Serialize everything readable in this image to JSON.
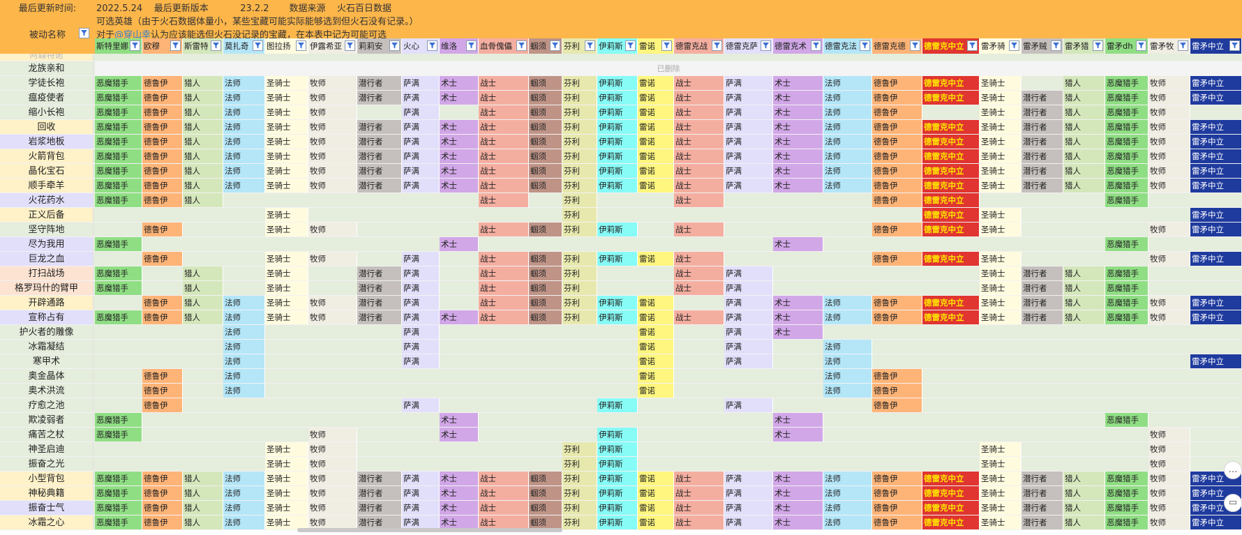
{
  "meta_header": {
    "update_time_label": "最后更新时间:",
    "date": "2022.5.24",
    "version_label": "最后更新版本",
    "version": "23.2.2",
    "source_label": "数据来源",
    "source": "火石百日数据",
    "note1": "可选英雄（由于火石数据体量小，某些宝藏可能实际能够选到但火石没有记录。）",
    "note2_prefix": "对于",
    "note2_mention": "@穿山幸",
    "note2_suffix": "认为应该能选但火石没记录的宝藏，在本表中记为可能可选",
    "name_header": "被动名称"
  },
  "columns": [
    {
      "label": "斯特里娜",
      "bg": "#90de84"
    },
    {
      "label": "欧穆",
      "bg": "#ffb477"
    },
    {
      "label": "斯雷特",
      "bg": "#d4e7bb"
    },
    {
      "label": "莫扎奇",
      "bg": "#b4e6f8"
    },
    {
      "label": "图拉扬",
      "bg": "#fffbdf"
    },
    {
      "label": "伊露希亚",
      "bg": "#f0ede3"
    },
    {
      "label": "莉莉安",
      "bg": "#c5c0bd"
    },
    {
      "label": "火心",
      "bg": "#e2dffb"
    },
    {
      "label": "维洛",
      "bg": "#d1a7e7"
    },
    {
      "label": "血骨傀儡",
      "bg": "#f4aea0"
    },
    {
      "label": "蝈须",
      "bg": "#bf9487"
    },
    {
      "label": "芬利",
      "bg": "#e7e8ad"
    },
    {
      "label": "伊莉斯",
      "bg": "#87fbf6"
    },
    {
      "label": "雷诺",
      "bg": "#fef67e"
    },
    {
      "label": "德雷克战",
      "bg": "#f4aea0"
    },
    {
      "label": "德雷克萨",
      "bg": "#e2dffb"
    },
    {
      "label": "德雷克术",
      "bg": "#d1a7e7"
    },
    {
      "label": "德雷克法",
      "bg": "#b4e6f8"
    },
    {
      "label": "德雷克德",
      "bg": "#ffb477"
    },
    {
      "label": "德雷克中立",
      "bg": "#e03530",
      "hot": true
    },
    {
      "label": "雷矛骑",
      "bg": "#fffbdf"
    },
    {
      "label": "雷矛贼",
      "bg": "#c5c0bd"
    },
    {
      "label": "雷矛猎",
      "bg": "#d4e7bb"
    },
    {
      "label": "雷矛dh",
      "bg": "#90de84"
    },
    {
      "label": "雷矛牧",
      "bg": "#f0ede3"
    },
    {
      "label": "雷矛中立",
      "bg": "#1f3b9e",
      "navy": true
    }
  ],
  "hero_values": [
    "恶魔猎手",
    "德鲁伊",
    "猎人",
    "法师",
    "圣骑士",
    "牧师",
    "潜行者",
    "萨满",
    "术士",
    "战士",
    "蝈须",
    "芬利",
    "伊莉斯",
    "雷诺",
    "战士",
    "萨满",
    "术士",
    "法师",
    "德鲁伊",
    "德雷克中立",
    "圣骑士",
    "潜行者",
    "猎人",
    "恶魔猎手",
    "牧师",
    "雷矛中立"
  ],
  "deleted_label": "已删除",
  "rows": [
    {
      "name": "阿森特诺",
      "cells": "",
      "name_bg": "#fff1c8",
      "partial": true
    },
    {
      "name": "龙族亲和",
      "deleted": true,
      "name_bg": "#e5eddd"
    },
    {
      "name": "学徒长袍",
      "cells": "11111111111111111111101111",
      "name_bg": "#e5eddd"
    },
    {
      "name": "瘟疫使者",
      "cells": "11111111111111111111111111",
      "name_bg": "#e5eddd"
    },
    {
      "name": "缩小长袍",
      "cells": "11111101011111111110111110",
      "name_bg": "#e5eddd"
    },
    {
      "name": "回收",
      "cells": "11111111111111111111111111",
      "name_bg": "#fff1c8"
    },
    {
      "name": "岩浆地板",
      "cells": "11111111111111111111111111",
      "name_bg": "#e2dffb"
    },
    {
      "name": "火箭背包",
      "cells": "11111111111111111111111111",
      "name_bg": "#fff1c8"
    },
    {
      "name": "晶化宝石",
      "cells": "11111111111111111111111111",
      "name_bg": "#fff1c8"
    },
    {
      "name": "顺手牵羊",
      "cells": "11111111111111111111111111",
      "name_bg": "#fff1c8"
    },
    {
      "name": "火花药水",
      "cells": "11100000010100100011000100",
      "name_bg": "#e2dffb"
    },
    {
      "name": "正义后备",
      "cells": "00001000000100000001100001",
      "name_bg": "#fff1c8"
    },
    {
      "name": "坚守阵地",
      "cells": "01001100011110100011100011",
      "name_bg": "#e5eddd"
    },
    {
      "name": "尽为我用",
      "cells": "10000000100000001000000100",
      "name_bg": "#e2dffb"
    },
    {
      "name": "巨龙之血",
      "cells": "01001101011111100011100011",
      "name_bg": "#e2dffb"
    },
    {
      "name": "打扫战场",
      "cells": "10101011011100110000111100",
      "name_bg": "#fde3d2"
    },
    {
      "name": "格罗玛什的臂甲",
      "cells": "10101011011100110000111100",
      "name_bg": "#fde3d2"
    },
    {
      "name": "开辟通路",
      "cells": "01111111011111011111111111",
      "name_bg": "#fff1c8"
    },
    {
      "name": "宣称占有",
      "cells": "11111111111111111111111111",
      "name_bg": "#e2dffb"
    },
    {
      "name": "护火者的雕像",
      "cells": "00010001000001011000000000",
      "name_bg": "#e5eddd"
    },
    {
      "name": "冰霜凝结",
      "cells": "00010001000001010100000000",
      "name_bg": "#e5eddd"
    },
    {
      "name": "寒甲术",
      "cells": "00010001000001010100000001",
      "name_bg": "#e5eddd"
    },
    {
      "name": "奥金晶体",
      "cells": "01010000000001000110000000",
      "name_bg": "#e5eddd"
    },
    {
      "name": "奥术洪流",
      "cells": "01010000000001000110000000",
      "name_bg": "#e5eddd"
    },
    {
      "name": "疗愈之池",
      "cells": "01000001000010010010000000",
      "name_bg": "#e5eddd"
    },
    {
      "name": "欺凌弱者",
      "cells": "10000000100000001000000100",
      "name_bg": "#e5eddd"
    },
    {
      "name": "痛苦之杖",
      "cells": "10000100100010001000000010",
      "name_bg": "#e5eddd"
    },
    {
      "name": "神圣启迪",
      "cells": "00001100000110000000100010",
      "name_bg": "#e5eddd"
    },
    {
      "name": "振奋之光",
      "cells": "00001100000110000000100010",
      "name_bg": "#e5eddd"
    },
    {
      "name": "小型背包",
      "cells": "11111111111111111111111111",
      "name_bg": "#fff1c8"
    },
    {
      "name": "神秘典籍",
      "cells": "11111111111111111111111111",
      "name_bg": "#fff1c8"
    },
    {
      "name": "振奋士气",
      "cells": "11111111111111111111111111",
      "name_bg": "#e2dffb"
    },
    {
      "name": "冰霜之心",
      "cells": "11111111111111111111111111",
      "name_bg": "#fff1c8",
      "partial": true
    }
  ],
  "right_floating": {
    "more_icon": "…",
    "panel_icon": "▭"
  }
}
